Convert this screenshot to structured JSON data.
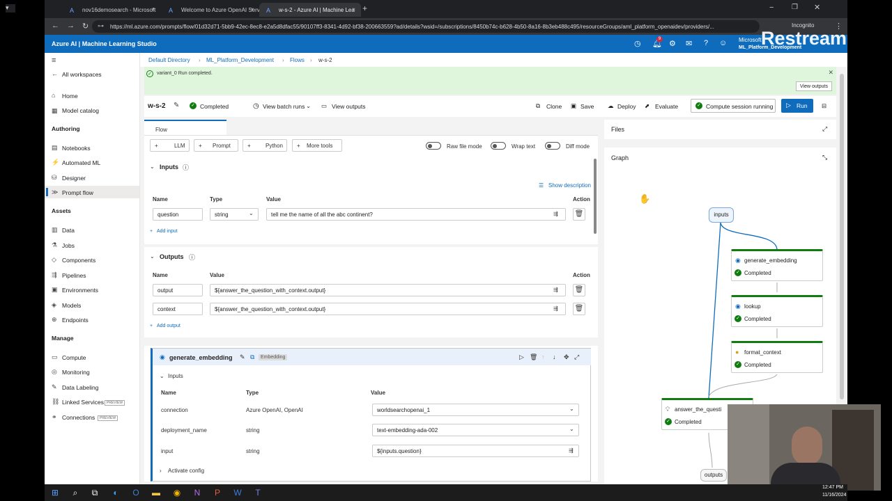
{
  "browser": {
    "tabs": [
      {
        "label": "nov16demosearch - Microsoft"
      },
      {
        "label": "Welcome to Azure OpenAI Serv"
      },
      {
        "label": "w-s-2 - Azure AI | Machine Lea"
      }
    ],
    "url": "https://ml.azure.com/prompts/flow/01d32d71-5bb9-42ec-8ec8-e2a5d8dfac55/90107ff3-8341-4d92-bf38-200663559?ad/details?wsid=/subscriptions/8450b74c-b628-4b50-8a16-8b3eb488c495/resourceGroups/aml_platform_openaidev/providers/...",
    "incognito": "Incognito"
  },
  "app": {
    "title": "Azure AI | Machine Learning Studio",
    "account_name": "Microsoft",
    "workspace": "ML_Platform_Development",
    "notification_count": "9",
    "watermark": "Restream"
  },
  "sidebar": {
    "all_workspaces": "All workspaces",
    "items_top": [
      {
        "label": "Home",
        "icon": "⌂"
      },
      {
        "label": "Model catalog",
        "icon": "▦"
      }
    ],
    "authoring_header": "Authoring",
    "authoring": [
      {
        "label": "Notebooks",
        "icon": "▤"
      },
      {
        "label": "Automated ML",
        "icon": "⚡"
      },
      {
        "label": "Designer",
        "icon": "⛁"
      },
      {
        "label": "Prompt flow",
        "icon": "≫"
      }
    ],
    "assets_header": "Assets",
    "assets": [
      {
        "label": "Data",
        "icon": "▥"
      },
      {
        "label": "Jobs",
        "icon": "⚗"
      },
      {
        "label": "Components",
        "icon": "◇"
      },
      {
        "label": "Pipelines",
        "icon": "⇶"
      },
      {
        "label": "Environments",
        "icon": "▣"
      },
      {
        "label": "Models",
        "icon": "◈"
      },
      {
        "label": "Endpoints",
        "icon": "⊕"
      }
    ],
    "manage_header": "Manage",
    "manage": [
      {
        "label": "Compute",
        "icon": "▭"
      },
      {
        "label": "Monitoring",
        "icon": "◎"
      },
      {
        "label": "Data Labeling",
        "icon": "✎"
      },
      {
        "label": "Linked Services",
        "icon": "⛓",
        "badge": "PREVIEW"
      },
      {
        "label": "Connections",
        "icon": "⚭",
        "badge": "PREVIEW"
      }
    ]
  },
  "breadcrumb": [
    "Default Directory",
    "ML_Platform_Development",
    "Flows",
    "w-s-2"
  ],
  "banner": {
    "message": "variant_0 Run completed.",
    "view_outputs": "View outputs"
  },
  "toolbar": {
    "flow_name": "w-s-2",
    "status": "Completed",
    "view_batch_runs": "View batch runs",
    "view_outputs": "View outputs",
    "clone": "Clone",
    "save": "Save",
    "deploy": "Deploy",
    "evaluate": "Evaluate",
    "compute_status": "Compute session running",
    "run": "Run"
  },
  "flow": {
    "tab": "Flow",
    "tools": [
      "LLM",
      "Prompt",
      "Python",
      "More tools"
    ],
    "toggles": [
      "Raw file mode",
      "Wrap text",
      "Diff mode"
    ],
    "inputs_title": "Inputs",
    "show_description": "Show description",
    "inputs_headers": [
      "Name",
      "Type",
      "Value",
      "Action"
    ],
    "input_row": {
      "name": "question",
      "type": "string",
      "value": "tell me the name of all the abc continent?"
    },
    "add_input": "Add input",
    "outputs_title": "Outputs",
    "outputs_headers": [
      "Name",
      "Value",
      "Action"
    ],
    "outputs": [
      {
        "name": "output",
        "value": "${answer_the_question_with_context.output}"
      },
      {
        "name": "context",
        "value": "${answer_the_question_with_context.output}"
      }
    ],
    "add_output": "Add output"
  },
  "node_card": {
    "name": "generate_embedding",
    "tag": "Embedding",
    "inputs_title": "Inputs",
    "headers": [
      "Name",
      "Type",
      "Value"
    ],
    "rows": [
      {
        "name": "connection",
        "type": "Azure OpenAI, OpenAI",
        "value": "worldsearchopenai_1"
      },
      {
        "name": "deployment_name",
        "type": "string",
        "value": "text-embedding-ada-002"
      },
      {
        "name": "input",
        "type": "string",
        "value": "${inputs.question}"
      }
    ],
    "activate_config": "Activate config"
  },
  "right_panel": {
    "files": "Files",
    "graph": "Graph",
    "inputs_node": "inputs",
    "outputs_node": "outputs",
    "nodes": [
      {
        "name": "generate_embedding",
        "status": "Completed"
      },
      {
        "name": "lookup",
        "status": "Completed"
      },
      {
        "name": "format_context",
        "status": "Completed"
      },
      {
        "name": "answer_the_questi",
        "status": "Completed"
      }
    ]
  },
  "taskbar": {
    "time": "12:47 PM",
    "date": "11/16/2024"
  },
  "colors": {
    "accent": "#0f6cbd",
    "success": "#107c10",
    "banner": "#dff6dd"
  }
}
